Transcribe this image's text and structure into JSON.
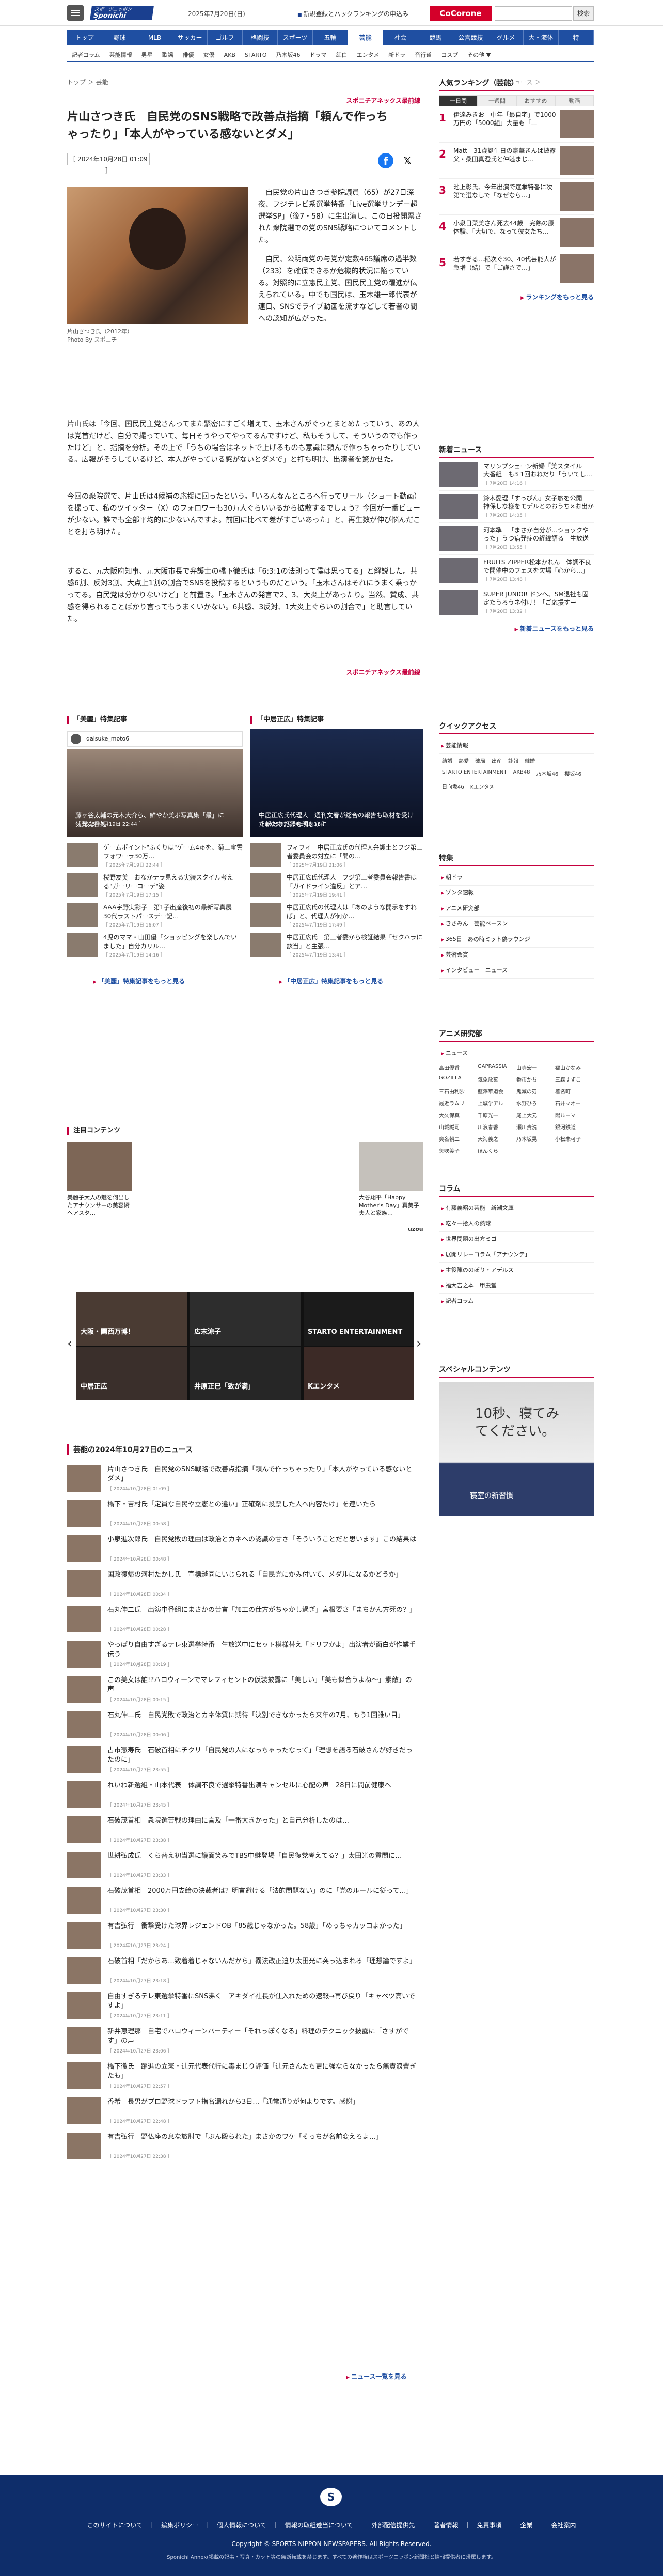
{
  "header": {
    "logo_top": "スポーツニッポン",
    "logo": "Sponichi Annex",
    "date": "2025年7月20日(日)",
    "register": "新規登録とパックランキングの申込み",
    "corone": "CoCorone",
    "search_button": "検索"
  },
  "nav1": [
    "トップ",
    "野球",
    "MLB",
    "サッカー",
    "ゴルフ",
    "格闘技",
    "スポーツ",
    "五輪",
    "芸能",
    "社会",
    "競馬",
    "公営競技",
    "グルメ",
    "大・海体",
    "特"
  ],
  "nav1_active": 8,
  "nav2": [
    "記者コラム",
    "芸能情報",
    "男星",
    "歌謡",
    "俳優",
    "女優",
    "AKB",
    "STARTO",
    "乃木坂46",
    "ドラマ",
    "紅白",
    "エンタメ",
    "新ドラ",
    "音行道",
    "コスプ",
    "その他 ▼"
  ],
  "breadcrumb": "トップ ＞ 芸能",
  "breadcrumb_right": "前のニュース ＞",
  "article": {
    "source": "スポニチアネックス最前線",
    "title": "片山さつき氏　自民党のSNS戦略で改善点指摘「頼んで作っちゃったり」「本人がやっている感ないとダメ」",
    "date": "［ 2024年10月28日 01:09 ］",
    "caption": "片山さつき氏（2012年）",
    "caption2": "Photo By スポニチ",
    "lead": "自民党の片山さつき参院議員（65）が27日深夜、フジテレビ系選挙特番「Live選挙サンデー超選挙SP」（後7・58）に生出演し、この日投開票された衆院選での党のSNS戦略についてコメントした。",
    "lead2": "自民、公明両党の与党が定数465議席の過半数（233）を確保できるか危機的状況に陥っている。対照的に立憲民主党、国民民主党の躍進が伝えられている。中でも国民は、玉木雄一郎代表が連日、SNSでライブ動画を流すなどして若者の間への認知が広がった。",
    "p1": "片山氏は「今回、国民民主党さんってまた緊密にすごく増えて、玉木さんがぐっとまとめたっていう、あの人は党首だけど、自分で撮っていて、毎日そうやってやってるんですけど、私もそうして、そういうのでも作ったけど」と、指摘を分析。その上で「うちの場合はネットで上げるものも意識に頼んで作っちゃったりしている。広報がそうしているけど、本人がやっている感がないとダメで」と打ち明け、出演者を驚かせた。",
    "p2": "今回の衆院選で、片山氏は4候補の応援に回ったという。「いろんなんところへ行ってリール（ショート動画）を撮って、私のツイッター（X）のフォロワーも30万人ぐらいいるから拡散するでしょう？今回が一番ビューが少ない。誰でも全部平均的に少ないんですよ。前回に比べて差がすごいあった」と、再生数が伸び悩んだことを打ち明けた。",
    "p3": "すると、元大阪府知事、元大阪市長で弁護士の橋下徹氏は「6:3:1の法則って僕は思ってる」と解説した。共感6割、反対3割、大点上1割の割合でSNSを投稿するというものだという。「玉木さんはそれにうまく乗っかってる。自民党は分かりないけど」と前置き。「玉木さんの発言で2、3、大炎上があったり。当然、賛成、共感を得られることばかり言ってもうまくいかない。6共感、3反対、1大炎上ぐらいの割合で」と助言していた。",
    "source_bottom": "スポニチアネックス最前線"
  },
  "feature_left": {
    "title": "「美麗」特集記事",
    "channel": "daisuke_moto6",
    "hero": "藤ヶ谷太輔の元木大介ら、鮮やか美ボ写真集「最」に一気発売目処",
    "hero_date": "［ 2025年7月19日 22:44 ］",
    "items": [
      {
        "text": "ゲームポイント\"ふくりは\"ゲーム4ゅを、菊三宝雲　フォワーラ30万…",
        "date": "［ 2025年7月19日 22:44 ］"
      },
      {
        "text": "桜野友美　おなかテラ見える実装スタイル考える\"ガーリーコーデ\"姿",
        "date": "［ 2025年7月19日 17:15 ］"
      },
      {
        "text": "AAA宇野実彩子　第1子出産後初の最新写真展　30代ラストパースデー記…",
        "date": "［ 2025年7月19日 16:07 ］"
      },
      {
        "text": "4児のママ・山田優「ショッピングを楽しんでいました」自分カリル…",
        "date": "［ 2025年7月19日 14:16 ］"
      }
    ],
    "more": "「美麗」特集記事をもっと見る"
  },
  "feature_right": {
    "title": "「中居正広」特集記事",
    "hero": "中居正広氏代理人　週刊文春が総合の報告も取材を受けた新たな記録を明らかに",
    "hero_date": "［ 2025年7月14日 15:18 ］",
    "items": [
      {
        "text": "フィフィ　中居正広氏の代理人弁護士とフジ第三者委員会の対立に「間の…",
        "date": "［ 2025年7月19日 21:06 ］"
      },
      {
        "text": "中居正広氏代理人　フジ第三者委員会報告書は「ガイドライン違反」とア…",
        "date": "［ 2025年7月19日 19:41 ］"
      },
      {
        "text": "中居正広氏の代理人は「あのような開示をすれば」と、代理人が何か…",
        "date": "［ 2025年7月19日 17:49 ］"
      },
      {
        "text": "中居正広氏　第三者委から検証結果「セクハラに該当」と主張…",
        "date": "［ 2025年7月19日 13:41 ］"
      }
    ],
    "more": "「中居正広」特集記事をもっと見る"
  },
  "recommend": {
    "title": "注目コンテンツ",
    "left": {
      "text": "美麗子大人の魅を何出したアナウンサーの美容術　ヘアスタ…"
    },
    "right": {
      "text": "大谷翔平「Happy Mother's Day」真美子夫人と家族…"
    },
    "brand": "uzou"
  },
  "carousel": [
    "大阪・関西万博！",
    "広末涼子",
    "STARTO ENTERTAINMENT",
    "中居正広",
    "井原正巳「致が満」",
    "Kエンタメ"
  ],
  "news": {
    "title": "芸能の2024年10月27日のニュース",
    "items": [
      {
        "text": "片山さつき氏　自民党のSNS戦略で改善点指摘「頼んで作っちゃったり」「本人がやっている感ないとダメ」",
        "date": "［ 2024年10月28日 01:09 ］"
      },
      {
        "text": "橋下・吉村氏「定員な自民や立憲との違い」正確剤に投票した人へ内容たけ」を連いたら",
        "date": "［ 2024年10月28日 00:58 ］"
      },
      {
        "text": "小泉進次郎氏　自民党敗の理由は政治とカネへの認識の甘さ「そういうことだと思います」この結果は",
        "date": "［ 2024年10月28日 00:48 ］"
      },
      {
        "text": "国政復帰の河村たかし氏　宣標越同にいじられる「自民党にかみ付いて、メダルになるかどうか」",
        "date": "［ 2024年10月28日 00:34 ］"
      },
      {
        "text": "石丸伸二氏　出演中番組にまさかの苦言「加工の仕方がちゃかし過ぎ」宮根要さ「まちかん方死の？」",
        "date": "［ 2024年10月28日 00:28 ］"
      },
      {
        "text": "やっぱり自由すぎるテレ東選挙特番　生放送中にセット模様替え「ドリフかよ」出演者が面白が作業手伝う",
        "date": "［ 2024年10月28日 00:19 ］"
      },
      {
        "text": "この美女は誰!?ハロウィーンでマレフィセントの仮装披露に「美しい」「美も似合うよね～」素敵」の声",
        "date": "［ 2024年10月28日 00:15 ］"
      },
      {
        "text": "石丸伸二氏　自民党敗で政治とカネ体質に期待「決別できなかったら来年の7月、もう1回誰い目」",
        "date": "［ 2024年10月28日 00:06 ］"
      },
      {
        "text": "古市憲寿氏　石破首相にチクリ「自民党の人になっちゃったなって」「理想を語る石破さんが好きだったのに」",
        "date": "［ 2024年10月27日 23:55 ］"
      },
      {
        "text": "れいわ新選組・山本代表　体調不良で選挙特番出演キャンセルに心配の声　28日に間前健康へ",
        "date": "［ 2024年10月27日 23:45 ］"
      },
      {
        "text": "石破茂首相　衆院選苦戦の理由に言及「一番大きかった」と自己分析したのは…",
        "date": "［ 2024年10月27日 23:38 ］"
      },
      {
        "text": "世耕弘成氏　くら替え初当選に議面笑みでTBS中継登場「自民復党考えてる？」太田光の質問に…",
        "date": "［ 2024年10月27日 23:33 ］"
      },
      {
        "text": "石破茂首相　2000万円支給の決裁者は？明言避ける「法的問題ない」のに「党のルールに従って…」",
        "date": "［ 2024年10月27日 23:30 ］"
      },
      {
        "text": "有吉弘行　衝撃受けた球界レジェンドOB「85歳じゃなかった。58歳」「めっちゃカッコよかった」",
        "date": "［ 2024年10月27日 23:24 ］"
      },
      {
        "text": "石破首相「だからあ…致着着じゃないんだから」霧法改正迫り太田光に突っ込まれる「理想論ですよ」",
        "date": "［ 2024年10月27日 23:18 ］"
      },
      {
        "text": "自由すぎるテレ東選挙特番にSNS沸く　アキダイ社長が仕入れための速報→再び戻り「キャベツ高いですよ」",
        "date": "［ 2024年10月27日 23:11 ］"
      },
      {
        "text": "新井恵理那　自宅でハロウィーンパーティー「それっぽくなる」料理のテクニック披露に「さすがです」の声",
        "date": "［ 2024年10月27日 23:06 ］"
      },
      {
        "text": "橋下徹氏　躍進の立憲・辻元代表代行に毒まじり評価「辻元さんたち更に強ならなかったら無責浪費ぎたも」",
        "date": "［ 2024年10月27日 22:57 ］"
      },
      {
        "text": "香希　長男がプロ野球ドラフト指名漏れから3日…「通常通りが何よりです。感謝」",
        "date": "［ 2024年10月27日 22:48 ］"
      },
      {
        "text": "有吉弘行　野仏座の息な旅肘で「ぶん殴られた」まさかのワケ「そっちが名前変えろよ…」",
        "date": "［ 2024年10月27日 22:38 ］"
      }
    ],
    "more": "ニュース一覧を見る"
  },
  "ranking": {
    "title": "人気ランキング（芸能）",
    "tabs": [
      "一日間",
      "一週間",
      "おすすめ",
      "動画"
    ],
    "items": [
      {
        "no": "1",
        "text": "伊達みきお　中年「最自宅」で1000万円の「5000組」大量も「…"
      },
      {
        "no": "2",
        "text": "Matt　31歳誕生日の豪華きんぱ披露　父・桑田真澄氏と仲睦まじ…"
      },
      {
        "no": "3",
        "text": "池上彰氏、今年出演で選挙特番に次第で選なしで「なぜなら…」"
      },
      {
        "no": "4",
        "text": "小泉日菜美さん死去44歳　完熟の原体験、「大切で、なって彼女たち…"
      },
      {
        "no": "5",
        "text": "若すぎる…稲次ぐ30、40代芸能人が急増（結）で「ご謹さで…」"
      }
    ],
    "more": "ランキングをもっと見る"
  },
  "new_news": {
    "title": "新着ニュース",
    "items": [
      {
        "text": "マリンプシェーン新婦「美スタイル－大番組－も3 1回おねだり「ういてし…",
        "date": "［ 7月20日 14:16 ］"
      },
      {
        "text": "鈴木愛理「すっぴん」女子旅を公開　神保しな様をモデルとのおうち×お出かけ…",
        "date": "［ 7月20日 14:05 ］"
      },
      {
        "text": "河本準一「まさか自分が…ショックやった」うつ病発症の経緯語る　生放送中…",
        "date": "［ 7月20日 13:55 ］"
      },
      {
        "text": "FRUITS ZIPPER松本かれん　体調不良で開催中のフェスを欠場「心から…」",
        "date": "［ 7月20日 13:48 ］"
      },
      {
        "text": "SUPER JUNIOR ドンヘ、SM退社も固定たうろうネ付け！「ご応援すーる」…",
        "date": "［ 7月20日 13:32 ］"
      }
    ],
    "more": "新着ニュースをもっと見る"
  },
  "quick": {
    "title": "クイックアクセス",
    "sub": "芸能情報",
    "links": [
      "結婚",
      "熱愛",
      "破局",
      "出産",
      "訃報",
      "離婚",
      "STARTO ENTERTAINMENT",
      "AKB48",
      "乃木坂46",
      "櫻坂46",
      "日向坂46",
      "Kエンタメ"
    ]
  },
  "special": {
    "title": "特集",
    "links": [
      "朝ドラ",
      "ゾンタ速報",
      "アニメ研究部",
      "きさみん　芸能ベースン",
      "365日　あの時ミット偽ラウンジ",
      "芸術会賞",
      "インタビュー　ニュース"
    ]
  },
  "anime": {
    "title": "アニメ研究部",
    "sub": "ニュース",
    "names": [
      "高田優香",
      "GAPRASSIA",
      "山寺宏一",
      "福山かなみ",
      "GOZILLA",
      "気象放棄",
      "番市かち",
      "三森すずこ",
      "三石由利沙",
      "藍澤華道会",
      "鬼滅の刃",
      "着名町",
      "最近ラムリ",
      "上城学アル",
      "水野ひろ",
      "石井マオー",
      "大久保真",
      "千原光一",
      "尾上大元",
      "陽ルーマ",
      "山城誠司",
      "川浪春香",
      "瀬川貴洗",
      "銀河鉄道",
      "奥名朝二",
      "天海義之",
      "乃木坂晃",
      "小松未可子",
      "矢吹美子",
      "ほんくら"
    ]
  },
  "column": {
    "title": "コラム",
    "links": [
      "有藤義昭の芸能　新潮文庫",
      "吃々一拾人の熱球",
      "世界問題の出方ミゴ",
      "展開リレーコラム「アナウンテ」",
      "主役陣ののぼり・アデルス",
      "福大吉之本　甲虫堂",
      "記者コラム"
    ]
  },
  "sponsor": {
    "title": "スペシャルコンテンツ",
    "ad": "10秒、寝てみてください。",
    "ad_brand": "寝室の新習慣"
  },
  "footer": {
    "links": "このサイトについて　｜　編集ポリシー　｜　個人情報について　｜　情報の取組遵当について　｜　外部配信提供先　｜　著者情報　｜　免責事項　｜　企業　｜　会社案内",
    "copyright": "Copyright © SPORTS NIPPON NEWSPAPERS. All Rights Reserved.",
    "disclaimer": "Sponichi Annex(掲載の記事・写真・カット等の無断転載を禁じます。すべての著作権はスポーツニッポン新聞社と情報提供者に帰属します。"
  }
}
